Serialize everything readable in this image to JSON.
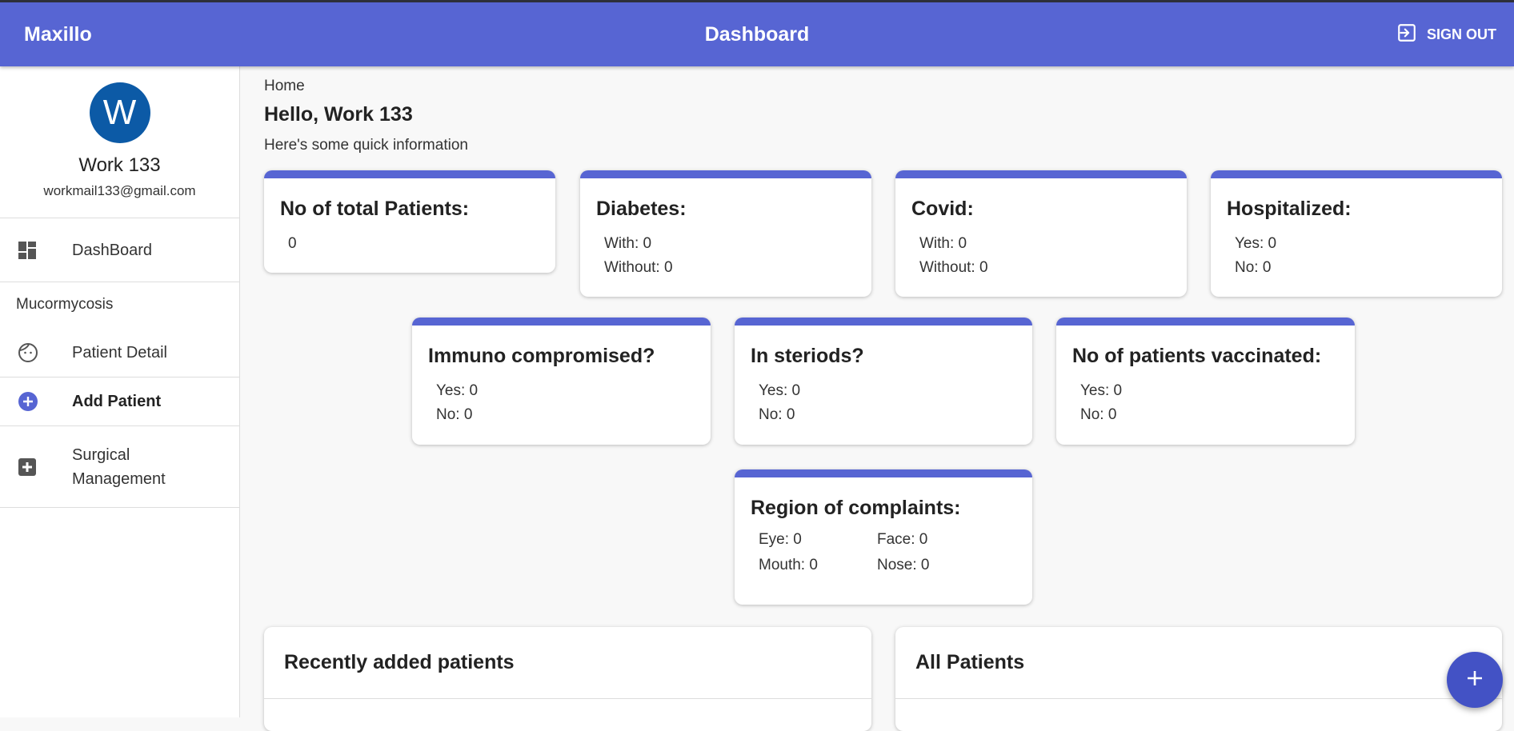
{
  "app": {
    "brand": "Maxillo",
    "page_title": "Dashboard",
    "signout_label": "SIGN OUT"
  },
  "user": {
    "initial": "W",
    "name": "Work 133",
    "email": "workmail133@gmail.com"
  },
  "sidebar": {
    "items": [
      {
        "label": "DashBoard",
        "icon": "dashboard-icon"
      },
      {
        "label": "Patient Detail",
        "icon": "face-icon"
      },
      {
        "label": "Add Patient",
        "icon": "add-circle-icon"
      },
      {
        "label": "Surgical Management",
        "icon": "medical-cross-icon"
      }
    ],
    "section_heading": "Mucormycosis"
  },
  "main": {
    "breadcrumb": "Home",
    "greeting": "Hello, Work 133",
    "subtitle": "Here's some quick information"
  },
  "cards": {
    "total": {
      "title": "No of total Patients:",
      "value": "0"
    },
    "diabetes": {
      "title": "Diabetes:",
      "l1": "With: 0",
      "l2": "Without: 0"
    },
    "covid": {
      "title": "Covid:",
      "l1": "With: 0",
      "l2": "Without: 0"
    },
    "hospitalized": {
      "title": "Hospitalized:",
      "l1": "Yes: 0",
      "l2": "No: 0"
    },
    "immuno": {
      "title": "Immuno compromised?",
      "l1": "Yes: 0",
      "l2": "No: 0"
    },
    "steroids": {
      "title": "In steriods?",
      "l1": "Yes: 0",
      "l2": "No: 0"
    },
    "vaccinated": {
      "title": "No of patients vaccinated:",
      "l1": "Yes: 0",
      "l2": "No: 0"
    },
    "region": {
      "title": "Region of complaints:",
      "eye": "Eye: 0",
      "face": "Face: 0",
      "mouth": "Mouth: 0",
      "nose": "Nose: 0"
    }
  },
  "panels": {
    "recent": "Recently added patients",
    "all": "All Patients"
  },
  "colors": {
    "primary": "#5765d3",
    "avatar": "#0c5aa6",
    "fab": "#4352c5"
  }
}
